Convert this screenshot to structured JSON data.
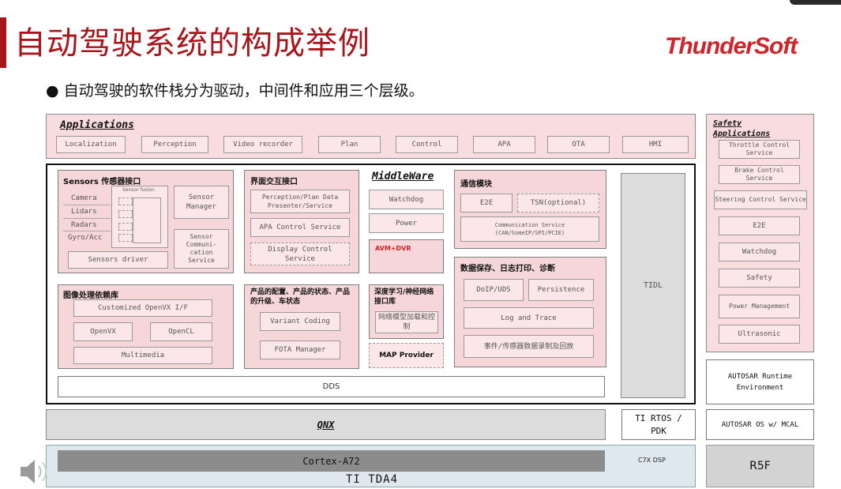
{
  "title": "自动驾驶系统的构成举例",
  "logo": "ThunderSoft",
  "bullet": "自动驾驶的软件栈分为驱动，中间件和应用三个层级。",
  "applications": {
    "title": "Applications",
    "items": [
      "Localization",
      "Perception",
      "Video recorder",
      "Plan",
      "Control",
      "APA",
      "OTA",
      "HMI"
    ]
  },
  "safety": {
    "title": "Safety Applications",
    "items": [
      "Throttle Control Service",
      "Brake Control Service",
      "Steering Control Service",
      "E2E",
      "Watchdog",
      "Safety",
      "Power Management",
      "Ultrasonic"
    ]
  },
  "sensors": {
    "title": "Sensors 传感器接口",
    "list": [
      "Camera",
      "Lidars",
      "Radars",
      "Gyro/Acc"
    ],
    "fusion": "Sensor fusion",
    "manager": "Sensor Manager",
    "comm": "Sensor Communi- cation Service",
    "driver": "Sensors driver"
  },
  "hmi_iface": {
    "title": "界面交互接口",
    "items": [
      "Perception/Plan Data Presenter/Service",
      "APA Control Service",
      "Display Control Service"
    ]
  },
  "middleware": {
    "title": "MiddleWare",
    "watchdog": "Watchdog",
    "power": "Power",
    "avm": "AVM+DVR"
  },
  "comm_module": {
    "title": "通信模块",
    "e2e": "E2E",
    "tsn": "TSN(optional)",
    "service": "Communication Service (CAN/SomeIP/SPI/PCIE)"
  },
  "data_module": {
    "title": "数据保存、日志打印、诊断",
    "doip": "DoIP/UDS",
    "persistence": "Persistence",
    "log": "Log and Trace",
    "event": "事件/传感器数据录制及回放"
  },
  "image_lib": {
    "title": "图像处理依赖库",
    "openvx_if": "Customized OpenVX I/F",
    "openvx": "OpenVX",
    "opencl": "OpenCL",
    "multimedia": "Multimedia"
  },
  "product": {
    "title": "产品的配置、产品的状态、产品的升级、车状态",
    "variant": "Variant Coding",
    "fota": "FOTA Manager"
  },
  "dl": {
    "title": "深度学习/神经网络接口库",
    "model": "网络模型加载和控制",
    "map": "MAP Provider"
  },
  "tidl": "TIDL",
  "dds": "DDS",
  "autosar_rte": "AUTOSAR Runtime Environment",
  "qnx": "QNX",
  "ti_rtos": "TI RTOS / PDK",
  "autosar_os": "AUTOSAR OS w/ MCAL",
  "cortex": "Cortex-A72",
  "c7x": "C7X DSP",
  "tda4": "TI TDA4",
  "r5f": "R5F"
}
